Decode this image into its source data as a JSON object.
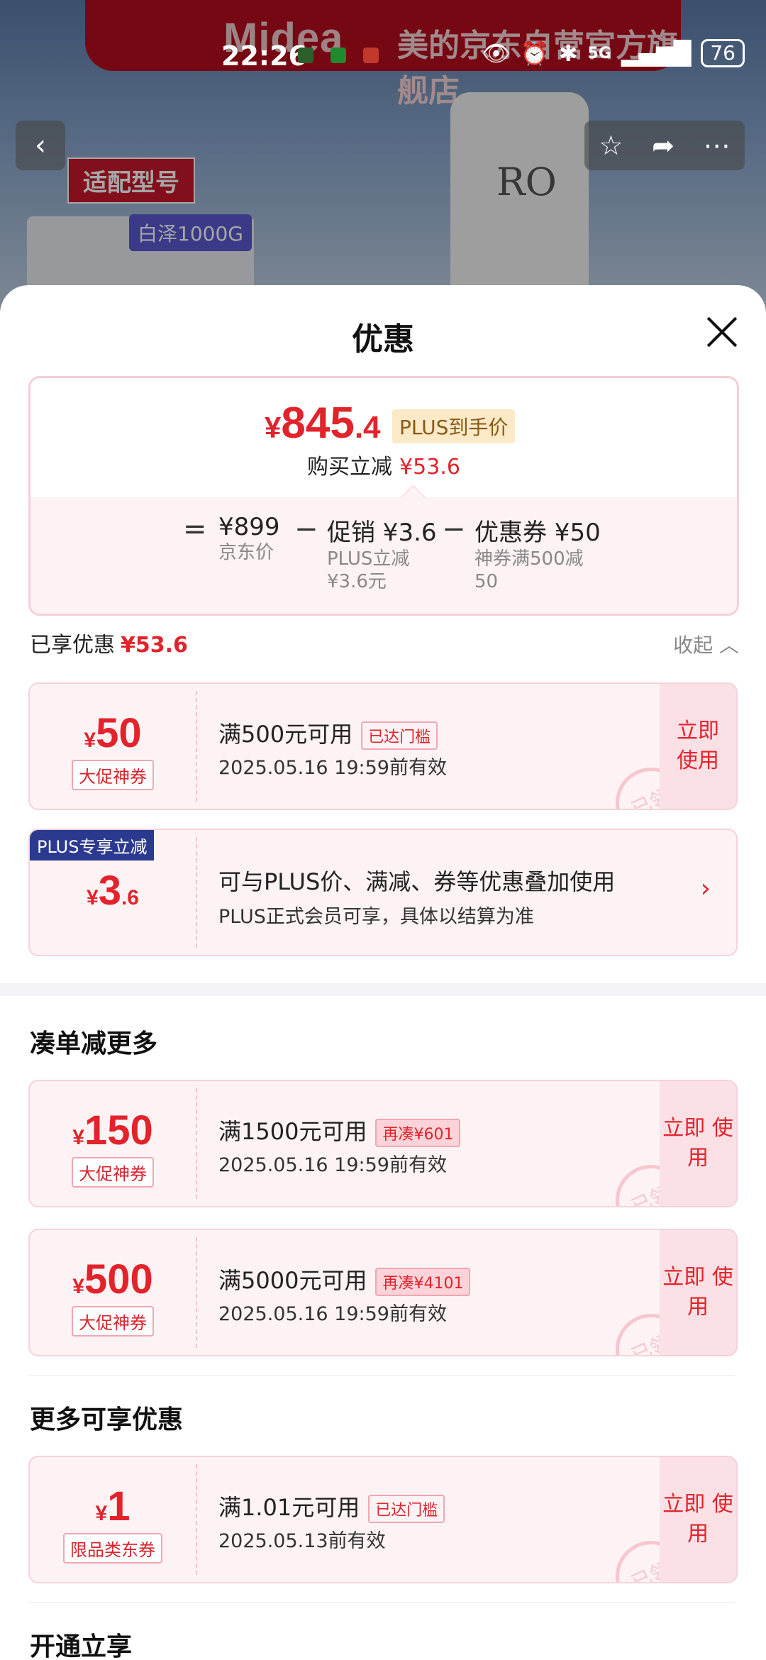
{
  "background": {
    "brand_logo": "Midea",
    "store_name": "美的京东自营官方旗舰店",
    "tag_label": "适配型号",
    "model_chip": "白泽1000G",
    "product_label": "RO"
  },
  "status_bar": {
    "time": "22:26",
    "network": "5G",
    "battery": "76"
  },
  "sheet": {
    "title": "优惠",
    "price_summary": {
      "currency": "¥",
      "price_int": "845",
      "price_dec": ".4",
      "price_tag": "PLUS到手价",
      "save_label": "购买立减",
      "save_amount": "¥53.6",
      "formula": {
        "equals": "=",
        "minus": "−",
        "jd_price": "¥899",
        "jd_price_label": "京东价",
        "promo": "促销 ¥3.6",
        "promo_sub1": "PLUS立减",
        "promo_sub2": "¥3.6元",
        "coupon": "优惠券 ¥50",
        "coupon_sub1": "神券满500减",
        "coupon_sub2": "50"
      }
    },
    "enjoyed": {
      "label": "已享优惠",
      "amount": "¥53.6",
      "collapse_label": "收起"
    },
    "coupons": [
      {
        "currency": "¥",
        "int": "50",
        "dec": "",
        "type": "大促神券",
        "condition": "满500元可用",
        "tag": "已达门槛",
        "validity": "2025.05.16 19:59前有效",
        "use_label": "立即\n使用",
        "stamp": "已领"
      }
    ],
    "plus": {
      "badge": "PLUS专享立减",
      "currency": "¥",
      "int": "3",
      "dec": ".6",
      "desc1": "可与PLUS价、满减、券等优惠叠加使用",
      "desc2": "PLUS正式会员可享，具体以结算为准",
      "arrow": "›"
    },
    "more_section": {
      "title": "凑单减更多",
      "coupons": [
        {
          "currency": "¥",
          "int": "150",
          "type": "大促神券",
          "condition": "满1500元可用",
          "tag": "再凑¥601",
          "validity": "2025.05.16 19:59前有效",
          "use_label": "立即 使用",
          "stamp": "已领"
        },
        {
          "currency": "¥",
          "int": "500",
          "type": "大促神券",
          "condition": "满5000元可用",
          "tag": "再凑¥4101",
          "validity": "2025.05.16 19:59前有效",
          "use_label": "立即 使用",
          "stamp": "已领"
        }
      ]
    },
    "extra_section": {
      "title": "更多可享优惠",
      "coupons": [
        {
          "currency": "¥",
          "int": "1",
          "type": "限品类东券",
          "condition": "满1.01元可用",
          "tag": "已达门槛",
          "validity": "2025.05.13前有效",
          "use_label": "立即 使用",
          "stamp": "已领"
        }
      ]
    },
    "open_section": {
      "title": "开通立享"
    }
  }
}
